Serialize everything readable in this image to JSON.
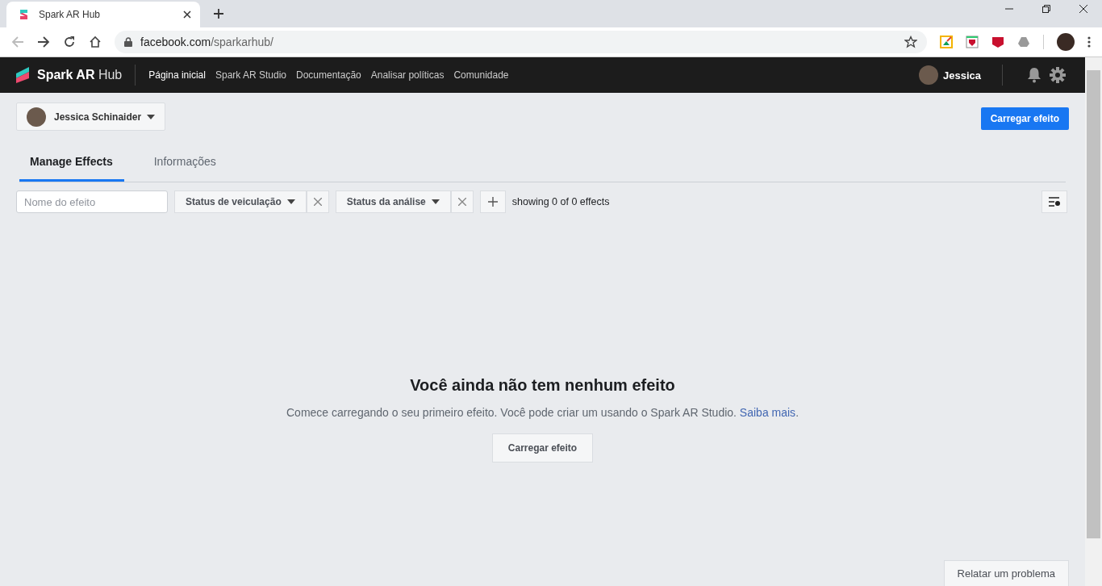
{
  "browser": {
    "tab_title": "Spark AR Hub",
    "url_domain": "facebook.com",
    "url_path": "/sparkarhub/"
  },
  "app_bar": {
    "logo_text": "Spark AR",
    "logo_suffix": "Hub",
    "user_name": "Jessica",
    "nav": [
      {
        "label": "Página inicial",
        "selected": true
      },
      {
        "label": "Spark AR Studio",
        "selected": false
      },
      {
        "label": "Documentação",
        "selected": false
      },
      {
        "label": "Analisar políticas",
        "selected": false
      },
      {
        "label": "Comunidade",
        "selected": false
      }
    ]
  },
  "account_selector": "Jessica Schinaider",
  "upload_button": "Carregar efeito",
  "tabs": [
    {
      "label": "Manage Effects",
      "selected": true
    },
    {
      "label": "Informações",
      "selected": false
    }
  ],
  "search": {
    "placeholder": "Nome do efeito"
  },
  "filters": [
    {
      "label": "Status de veiculação"
    },
    {
      "label": "Status da análise"
    }
  ],
  "count_text": "showing 0 of 0 effects",
  "empty_state": {
    "title": "Você ainda não tem nenhum efeito",
    "description": "Comece carregando o seu primeiro efeito. Você pode criar um usando o Spark AR Studio.",
    "link": "Saiba mais",
    "suffix": ".",
    "button": "Carregar efeito"
  },
  "report_button": "Relatar um problema"
}
